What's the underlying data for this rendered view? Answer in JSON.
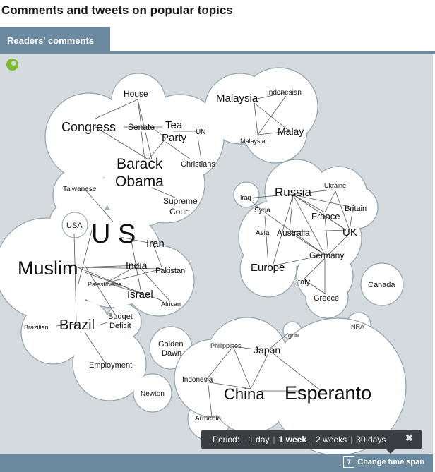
{
  "page": {
    "title": "Comments and tweets on popular topics"
  },
  "tab": {
    "label": "Readers' comments"
  },
  "period": {
    "label": "Period:",
    "options": [
      "1 day",
      "1 week",
      "2 weeks",
      "30 days"
    ],
    "selected": "1 week",
    "close": "✖"
  },
  "footer": {
    "change_time_span": "Change time span",
    "calendar_glyph": "7"
  },
  "colors": {
    "bubble_fill": "#ffffff",
    "bubble_stroke": "#8fa3ae",
    "panel_bg": "#d4dadd",
    "accent": "#6b8aa0",
    "link": "#555555"
  },
  "topics": [
    "House",
    "Congress",
    "Senate",
    "Tea",
    "Party",
    "UN",
    "Barack",
    "Obama",
    "Christians",
    "Supreme",
    "Court",
    "Malaysia",
    "Indonesian",
    "Malay",
    "Malaysian",
    "Taiwanese",
    "USA",
    "U S",
    "Iran",
    "Muslim",
    "India",
    "Pakistan",
    "Palestinians",
    "Israel",
    "African",
    "Budget",
    "Deficit",
    "Brazilian",
    "Brazil",
    "Employment",
    "Iraq",
    "Russia",
    "Ukraine",
    "Syria",
    "Britain",
    "France",
    "Asia",
    "Australia",
    "UK",
    "Germany",
    "Europe",
    "Italy",
    "Greece",
    "Canada",
    "NRA",
    "gun",
    "Golden",
    "Dawn",
    "Philippines",
    "Japan",
    "Indonesia",
    "China",
    "Esperanto",
    "Newton",
    "Armenia"
  ]
}
